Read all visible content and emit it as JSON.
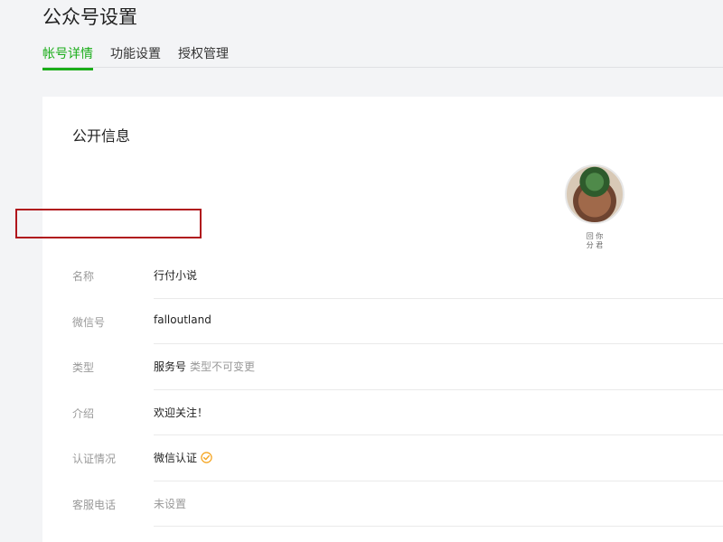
{
  "header": {
    "title": "公众号设置"
  },
  "tabs": [
    {
      "label": "帐号详情",
      "active": true
    },
    {
      "label": "功能设置",
      "active": false
    },
    {
      "label": "授权管理",
      "active": false
    }
  ],
  "section": {
    "title": "公开信息",
    "qr_label": "回 你\n分 君"
  },
  "rows": [
    {
      "label": "名称",
      "value": "行付小说"
    },
    {
      "label": "微信号",
      "value": "falloutland",
      "highlighted": true
    },
    {
      "label": "类型",
      "value": "服务号",
      "note": "类型不可变更"
    },
    {
      "label": "介绍",
      "value": "欢迎关注！"
    },
    {
      "label": "认证情况",
      "value": "微信认证",
      "verified_icon": "verified-check-icon"
    },
    {
      "label": "客服电话",
      "value": "未设置"
    }
  ],
  "colors": {
    "accent": "#1aad19",
    "highlight": "#b0151c",
    "verified": "#f5a623"
  }
}
